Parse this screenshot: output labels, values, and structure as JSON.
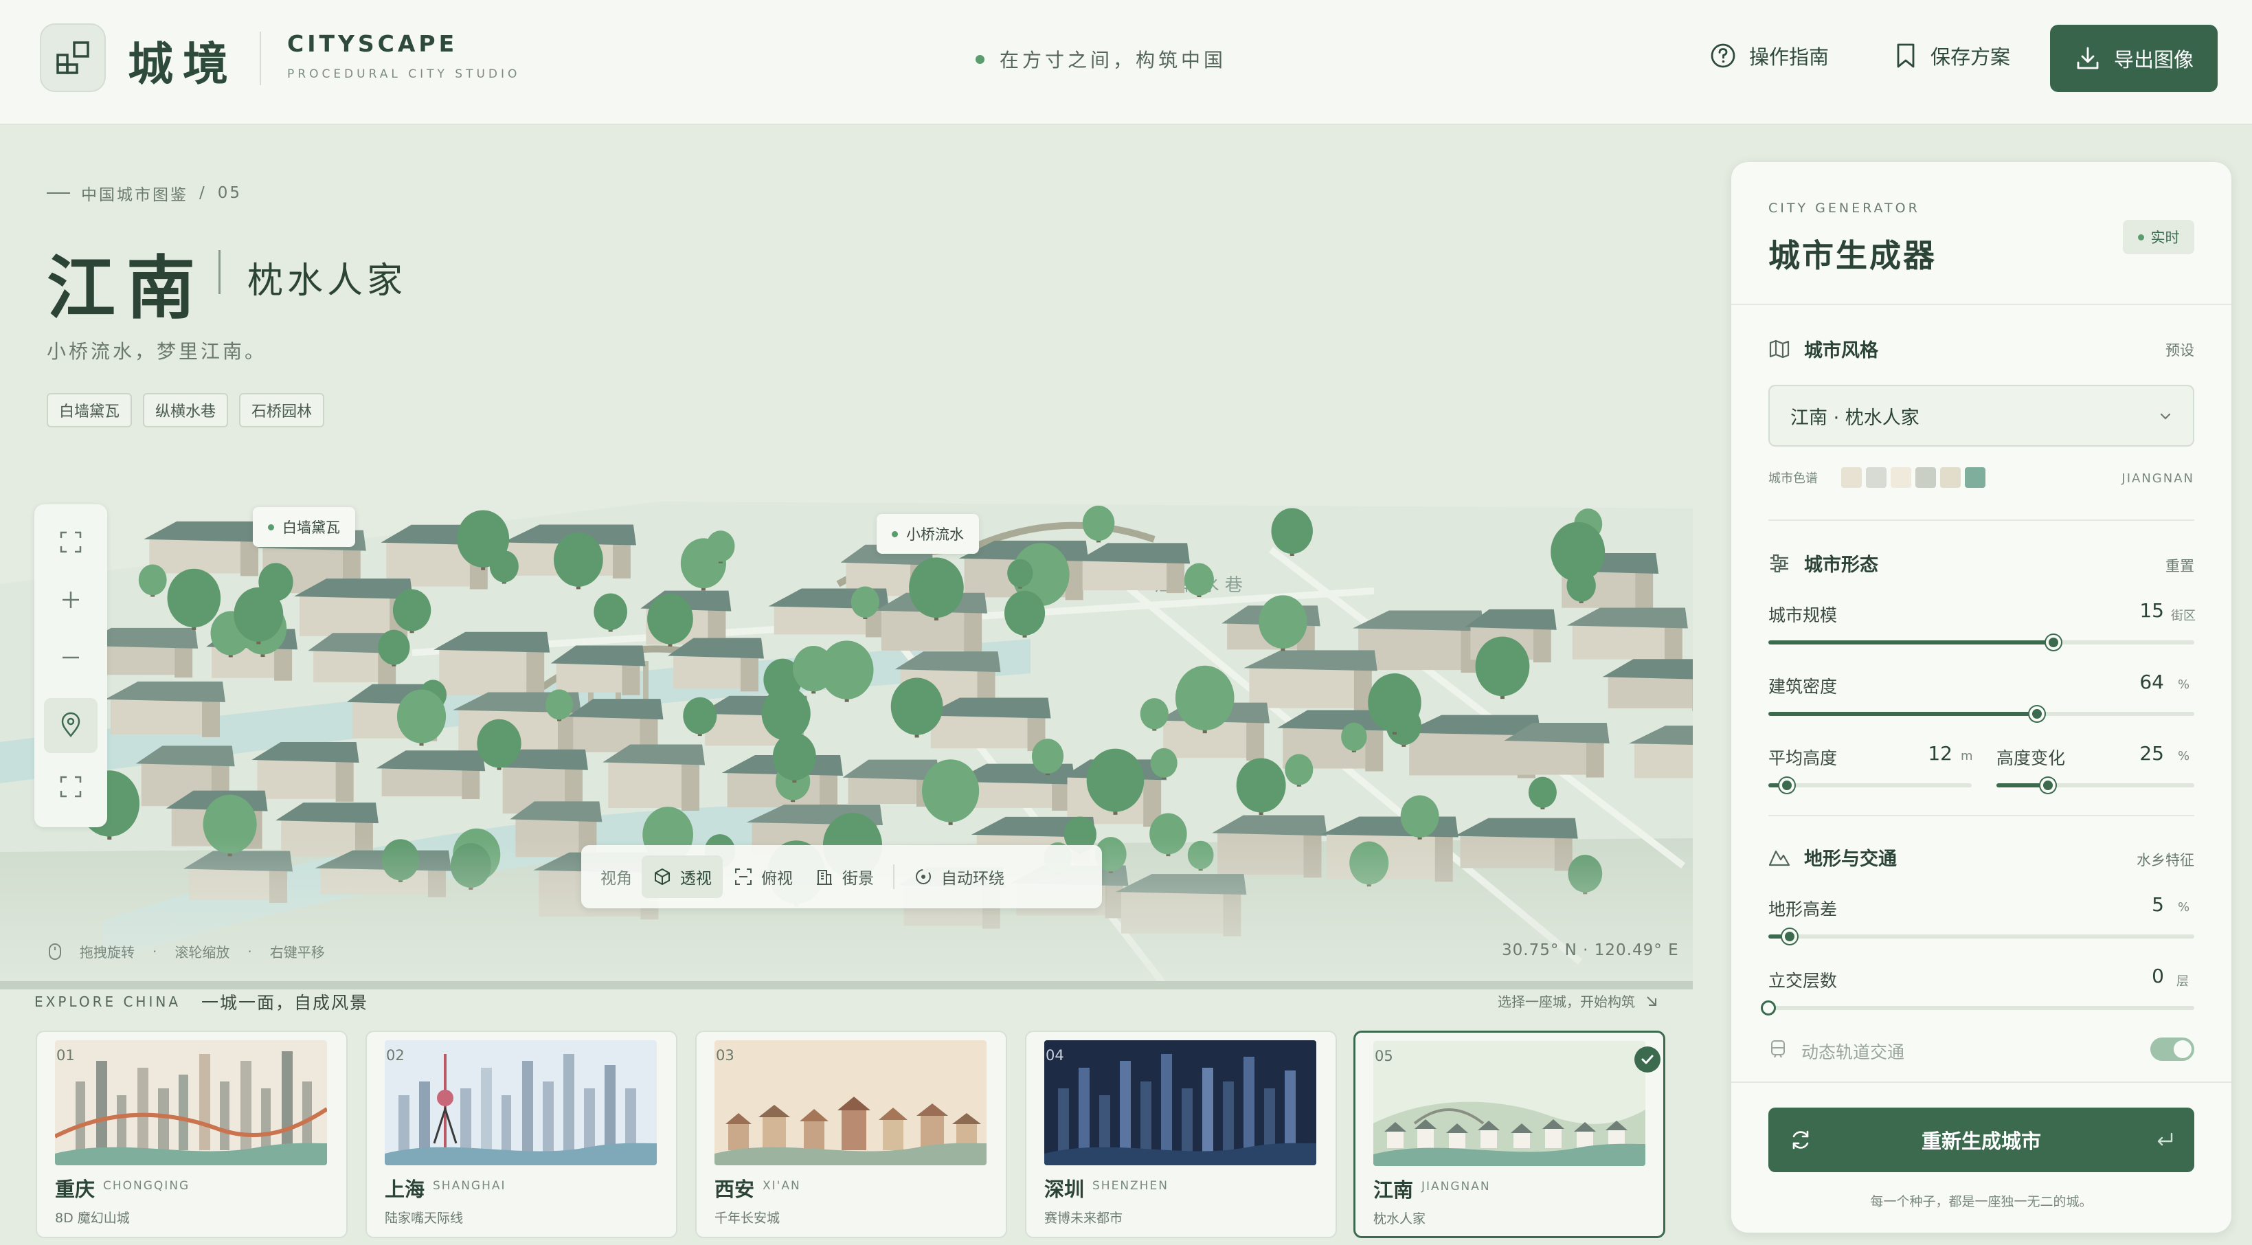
{
  "header": {
    "brand_cn": "城境",
    "brand_en": "CITYSCAPE",
    "brand_sub": "PROCEDURAL CITY STUDIO",
    "tagline": "在方寸之间，构筑中国",
    "guide_label": "操作指南",
    "save_label": "保存方案",
    "export_label": "导出图像"
  },
  "info": {
    "breadcrumb_section": "中国城市图鉴",
    "breadcrumb_sep": "/",
    "breadcrumb_index": "05",
    "title": "江南",
    "subtitle": "枕水人家",
    "description": "小桥流水，梦里江南。",
    "tags": [
      "白墙黛瓦",
      "纵横水巷",
      "石桥园林"
    ]
  },
  "scene": {
    "callouts": [
      "白墙黛瓦",
      "小桥流水"
    ],
    "canal_label": "江 南 水 巷",
    "view_label": "视角",
    "views": [
      "透视",
      "俯视",
      "街景"
    ],
    "auto_orbit": "自动环绕",
    "hint_drag": "拖拽旋转",
    "hint_scroll": "滚轮缩放",
    "hint_pan": "右键平移",
    "coords": "30.75° N · 120.49° E"
  },
  "explore": {
    "eyebrow": "EXPLORE CHINA",
    "title": "一城一面，自成风景",
    "hint": "选择一座城，开始构筑",
    "cards": [
      {
        "num": "01",
        "cn": "重庆",
        "en": "CHONGQING",
        "desc": "8D 魔幻山城"
      },
      {
        "num": "02",
        "cn": "上海",
        "en": "SHANGHAI",
        "desc": "陆家嘴天际线"
      },
      {
        "num": "03",
        "cn": "西安",
        "en": "XI'AN",
        "desc": "千年长安城"
      },
      {
        "num": "04",
        "cn": "深圳",
        "en": "SHENZHEN",
        "desc": "赛博未来都市"
      },
      {
        "num": "05",
        "cn": "江南",
        "en": "JIANGNAN",
        "desc": "枕水人家"
      }
    ]
  },
  "panel": {
    "eyebrow": "CITY GENERATOR",
    "title": "城市生成器",
    "live_label": "实时",
    "style_section": "城市风格",
    "style_action": "预设",
    "style_value": "江南 · 枕水人家",
    "palette_label": "城市色谱",
    "palette_code": "JIANGNAN",
    "palette": [
      "#e8e2d2",
      "#d8dbd3",
      "#f0eadd",
      "#c9cfc5",
      "#e2dccb",
      "#7fae9c"
    ],
    "form_section": "城市形态",
    "form_action": "重置",
    "scale": {
      "label": "城市规模",
      "value": "15",
      "unit": "街区",
      "fraction": 0.67
    },
    "density": {
      "label": "建筑密度",
      "value": "64",
      "unit": "%",
      "fraction": 0.63
    },
    "height": {
      "label": "平均高度",
      "value": "12",
      "unit": "m",
      "fraction": 0.09
    },
    "variance": {
      "label": "高度变化",
      "value": "25",
      "unit": "%",
      "fraction": 0.26
    },
    "terrain_section": "地形与交通",
    "terrain_action": "水乡特征",
    "elevation": {
      "label": "地形高差",
      "value": "5",
      "unit": "%",
      "fraction": 0.05
    },
    "levels": {
      "label": "立交层数",
      "value": "0",
      "unit": "层",
      "fraction": 0.0
    },
    "transit_label": "动态轨道交通",
    "regenerate_label": "重新生成城市",
    "footer": "每一个种子，都是一座独一无二的城。"
  }
}
